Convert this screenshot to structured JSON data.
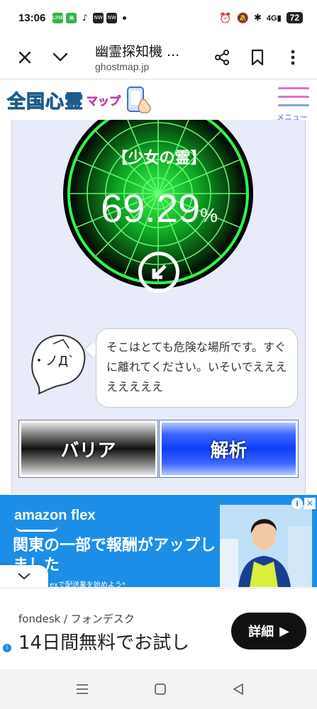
{
  "status_bar": {
    "time": "13:06",
    "notification_icons": [
      "LINE",
      "app",
      "tiktok",
      "news",
      "news"
    ],
    "network": "4G",
    "battery": "72"
  },
  "browser": {
    "page_title": "幽霊探知機 ...",
    "url": "ghostmap.jp",
    "icons": [
      "close-icon",
      "chevron-down-icon",
      "share-icon",
      "bookmark-icon",
      "more-vert-icon"
    ]
  },
  "site": {
    "logo_text": "全国心霊",
    "logo_sub": "マップ",
    "menu_label": "メニュー"
  },
  "radar": {
    "label": "【少女の霊】",
    "value": "69.29",
    "unit": "%"
  },
  "ghost": {
    "face": "・ノД`"
  },
  "message": {
    "text": "そこはとても危険な場所です。すぐに離れてください。いそいでええええええええ"
  },
  "buttons": {
    "barrier": "バリア",
    "analyze": "解析"
  },
  "ad_amazon": {
    "brand": "amazon flex",
    "headline": "関東の一部で報酬がアップしました",
    "sub": "exで配送業を始めよう*"
  },
  "ad_fondesk": {
    "brand": "fondesk / フォンデスク",
    "headline": "14日間無料でお試し",
    "cta": "詳細"
  },
  "colors": {
    "radar_green": "#22d43a",
    "analyze_blue": "#0e3ff5",
    "ad_blue": "#1c8ee8",
    "menu_pink": "#e070d0"
  }
}
